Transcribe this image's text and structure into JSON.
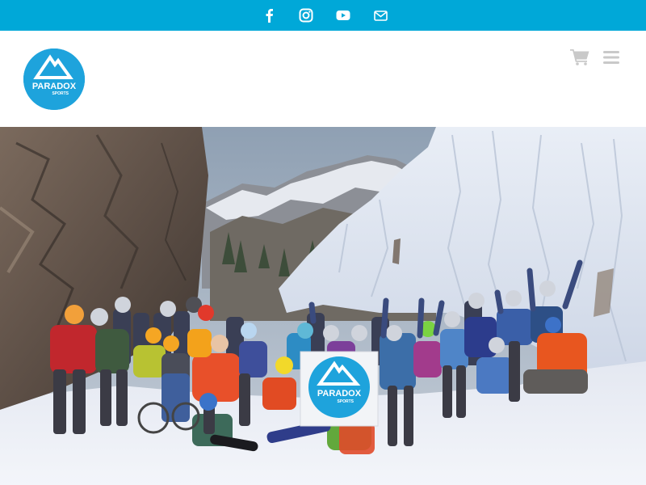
{
  "brand": {
    "name": "PARADOX",
    "tagline": "SPORTS",
    "primary_color": "#00a8d8",
    "logo_color": "#1ea3dc"
  },
  "top_bar": {
    "social_links": [
      {
        "icon": "facebook-icon"
      },
      {
        "icon": "instagram-icon"
      },
      {
        "icon": "youtube-icon"
      },
      {
        "icon": "email-icon"
      }
    ]
  },
  "header": {
    "cart_icon": "shopping-cart-icon",
    "menu_icon": "hamburger-menu-icon"
  },
  "hero": {
    "banner_text": "PARADOX",
    "banner_subtext": "SPORTS"
  }
}
